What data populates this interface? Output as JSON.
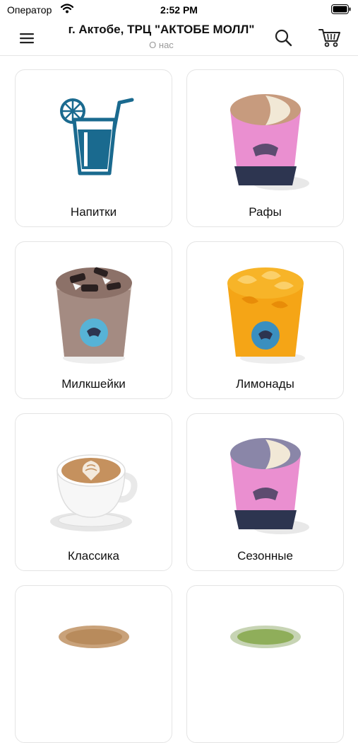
{
  "status_bar": {
    "carrier": "Оператор",
    "time": "2:52 PM"
  },
  "header": {
    "title": "г. Актобе, ТРЦ \"АКТОБЕ МОЛЛ\"",
    "subtitle": "О нас",
    "menu_icon": "hamburger-icon",
    "search_icon": "search-icon",
    "cart_icon": "cart-icon"
  },
  "categories": [
    {
      "label": "Напитки",
      "icon": "drink-glass-icon"
    },
    {
      "label": "Рафы",
      "icon": "raf-cup-image"
    },
    {
      "label": "Милкшейки",
      "icon": "milkshake-cup-image"
    },
    {
      "label": "Лимонады",
      "icon": "lemonade-cup-image"
    },
    {
      "label": "Классика",
      "icon": "cappuccino-cup-image"
    },
    {
      "label": "Сезонные",
      "icon": "seasonal-cup-image"
    }
  ],
  "colors": {
    "accent": "#1a6a8f",
    "card_border": "#e4e4e4",
    "cup_pink": "#ea8fd0",
    "cup_navy": "#2d3550"
  }
}
